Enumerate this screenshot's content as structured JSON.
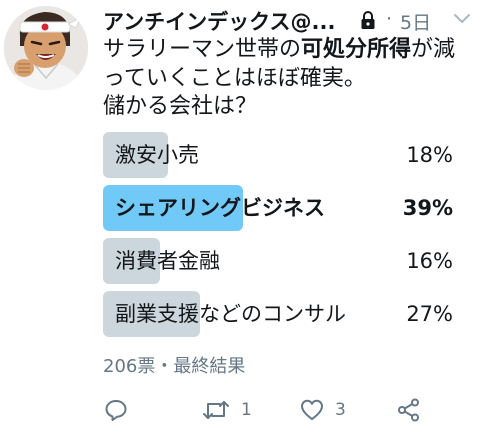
{
  "tweet": {
    "display_name": "アンチインデックス@...",
    "time_separator": "·",
    "timestamp": "5日",
    "text_lines": [
      {
        "before": "サラリーマン世帯の",
        "bold": "可処分所得",
        "after": "が減"
      },
      {
        "before": "っていくことはほぼ確実。",
        "bold": "",
        "after": ""
      },
      {
        "before": "儲かる会社は？",
        "bold": "",
        "after": ""
      }
    ]
  },
  "poll": {
    "options": [
      {
        "label": "激安小売",
        "percent_text": "18%",
        "percent": 18,
        "winner": false
      },
      {
        "label": "シェアリングビジネス",
        "percent_text": "39%",
        "percent": 39,
        "winner": true
      },
      {
        "label": "消費者金融",
        "percent_text": "16%",
        "percent": 16,
        "winner": false
      },
      {
        "label": "副業支援などのコンサル",
        "percent_text": "27%",
        "percent": 27,
        "winner": false
      }
    ],
    "meta": "206票・最終結果"
  },
  "actions": {
    "reply_count": "",
    "retweet_count": "1",
    "like_count": "3"
  },
  "icons": {
    "avatar": "avatar-image",
    "lock": "lock-icon",
    "chevron": "chevron-down-icon",
    "reply": "reply-icon",
    "retweet": "retweet-icon",
    "like": "heart-icon",
    "share": "share-icon"
  },
  "colors": {
    "text": "#14171a",
    "muted": "#657786",
    "bar": "#ccd6dd",
    "bar_winner": "#71c9f8"
  }
}
